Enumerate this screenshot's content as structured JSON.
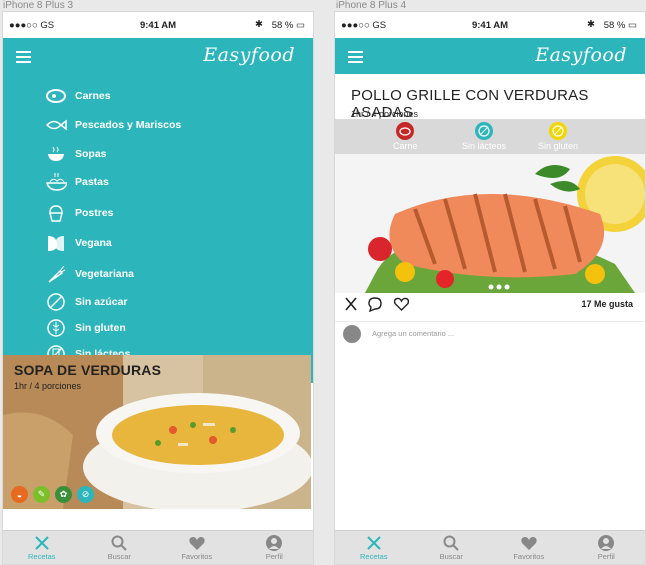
{
  "frames": {
    "left_label": "iPhone 8 Plus 3",
    "right_label": "iPhone 8 Plus 4"
  },
  "status": {
    "carrier": "●●●○○ GS",
    "time": "9:41 AM",
    "battery": "58 %"
  },
  "app": {
    "logo": "Easyfood",
    "accent": "#2cb6bb"
  },
  "menu": {
    "items": [
      {
        "label": "Carnes",
        "icon": "meat-icon"
      },
      {
        "label": "Pescados y Mariscos",
        "icon": "fish-icon"
      },
      {
        "label": "Sopas",
        "icon": "soup-icon"
      },
      {
        "label": "Pastas",
        "icon": "pasta-icon"
      },
      {
        "label": "Postres",
        "icon": "cupcake-icon"
      },
      {
        "label": "Vegana",
        "icon": "vegan-icon"
      },
      {
        "label": "Vegetariana",
        "icon": "carrot-icon"
      },
      {
        "label": "Sin azúcar",
        "icon": "no-sugar-icon"
      },
      {
        "label": "Sin gluten",
        "icon": "no-gluten-icon"
      },
      {
        "label": "Sin lácteos",
        "icon": "no-dairy-icon"
      }
    ]
  },
  "card": {
    "title": "SOPA DE VERDURAS",
    "subtitle": "1hr / 4 porciones",
    "badges": [
      "soup-badge",
      "vegetarian-badge",
      "vegan-badge",
      "no-dairy-badge"
    ]
  },
  "tabs": [
    {
      "label": "Recetas",
      "icon": "fork-knife-icon"
    },
    {
      "label": "Buscar",
      "icon": "search-icon"
    },
    {
      "label": "Favoritos",
      "icon": "heart-icon"
    },
    {
      "label": "Perfil",
      "icon": "profile-icon"
    }
  ],
  "recipe": {
    "title": "POLLO GRILLE CON VERDURAS ASADAS",
    "subtitle": "1hr / 4 porciones",
    "tags": [
      {
        "label": "Carne",
        "color": "#c62828"
      },
      {
        "label": "Sin lácteos",
        "color": "#2cb6bb"
      },
      {
        "label": "Sin gluten",
        "color": "#f2d600"
      }
    ],
    "likes": "17 Me gusta",
    "comment_placeholder": "Agrega un comentario ..."
  }
}
